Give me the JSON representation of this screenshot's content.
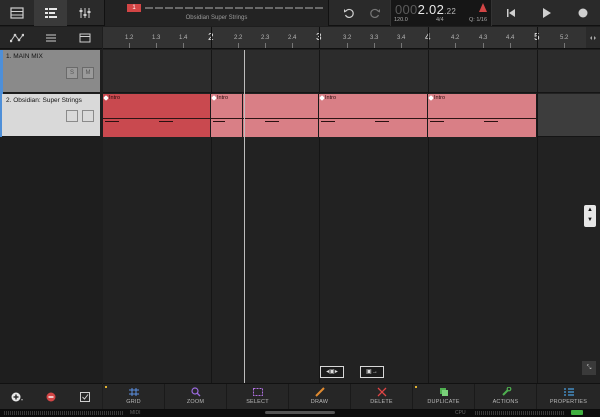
{
  "overview": {
    "marker_label": "1",
    "song_title": "Obsidian Super Strings"
  },
  "counter": {
    "position_dim": "000",
    "position_main": "2.02",
    "position_ticks": ".22",
    "tempo": "120.0",
    "time_signature": "4/4",
    "quantize": "Q: 1/16"
  },
  "ruler": {
    "ticks": [
      {
        "label": "1.2",
        "kind": "minor"
      },
      {
        "label": "1.3",
        "kind": "minor"
      },
      {
        "label": "1.4",
        "kind": "minor"
      },
      {
        "label": "2",
        "kind": "major"
      },
      {
        "label": "2.2",
        "kind": "minor"
      },
      {
        "label": "2.3",
        "kind": "minor"
      },
      {
        "label": "2.4",
        "kind": "minor"
      },
      {
        "label": "3",
        "kind": "major"
      },
      {
        "label": "3.2",
        "kind": "minor"
      },
      {
        "label": "3.3",
        "kind": "minor"
      },
      {
        "label": "3.4",
        "kind": "minor"
      },
      {
        "label": "4",
        "kind": "major"
      },
      {
        "label": "4.2",
        "kind": "minor"
      },
      {
        "label": "4.3",
        "kind": "minor"
      },
      {
        "label": "4.4",
        "kind": "minor"
      },
      {
        "label": "5",
        "kind": "major"
      },
      {
        "label": "5.2",
        "kind": "minor"
      }
    ]
  },
  "tracks": [
    {
      "name": "1. MAIN MIX",
      "solo_label": "S",
      "mute_label": "M"
    },
    {
      "name": "2. Obsidian: Super Strings",
      "solo_label": "",
      "mute_label": ""
    }
  ],
  "clips": [
    {
      "name": "Intro",
      "state": "selected"
    },
    {
      "name": "Intro",
      "state": "normal"
    },
    {
      "name": "",
      "state": "normal"
    },
    {
      "name": "Intro",
      "state": "normal"
    },
    {
      "name": "Intro",
      "state": "normal"
    }
  ],
  "toolbar": {
    "grid": "GRID",
    "zoom": "ZOOM",
    "select": "SELECT",
    "draw": "DRAW",
    "delete": "DELETE",
    "duplicate": "DUPLICATE",
    "actions": "ACTIONS",
    "properties": "PROPERTIES"
  },
  "status": {
    "left_label": "MIDI",
    "right_label": "CPU"
  },
  "colors": {
    "clip_selected": "#c9494f",
    "clip": "#d97f86",
    "accent_blue": "#4e8fd8",
    "record_red": "#d24545"
  },
  "icons": [
    "browser-icon",
    "tracks-icon",
    "mixer-icon",
    "undo-icon",
    "redo-icon",
    "go-to-start-icon",
    "play-icon",
    "record-icon",
    "automation-icon",
    "grid-menu-icon",
    "clip-list-icon",
    "add-track-icon",
    "remove-track-icon",
    "edit-check-icon"
  ]
}
